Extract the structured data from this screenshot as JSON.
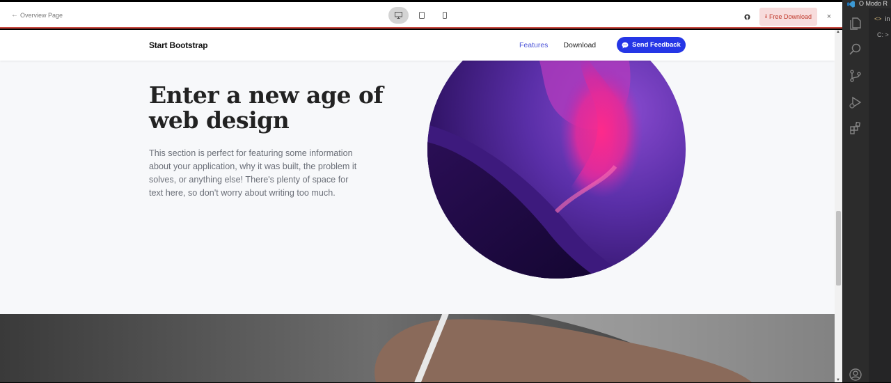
{
  "toolbar": {
    "back_label": "Overview Page",
    "free_download_label": "Free Download",
    "close_glyph": "×",
    "devices": [
      "desktop-icon",
      "tablet-icon",
      "phone-icon"
    ],
    "active_device": "desktop"
  },
  "navbar": {
    "brand": "Start Bootstrap",
    "links": [
      {
        "label": "Features",
        "active": true
      },
      {
        "label": "Download",
        "active": false
      }
    ],
    "feedback_button": "Send Feedback"
  },
  "hero": {
    "title": "Enter a new age of web design",
    "text": "This section is perfect for featuring some information about your application, why it was built, the problem it solves, or anything else! There's plenty of space for text here, so don't worry about writing too much."
  },
  "vscode": {
    "title": "O Modo R",
    "tab_label": "in",
    "path_fragment": "C: >"
  },
  "colors": {
    "accent": "#2536e6",
    "nav_active": "#4c54d8",
    "toolbar_border": "#c9463d",
    "download_bg": "#f7dcdc",
    "download_text": "#c0392b"
  }
}
